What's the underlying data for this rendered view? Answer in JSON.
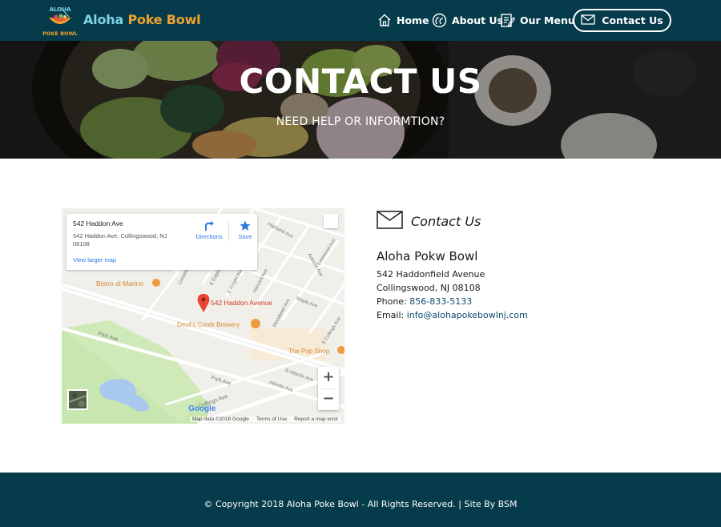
{
  "header": {
    "brand_part1": "Aloha",
    "brand_part2": "Poke Bowl",
    "logo_text_top": "ALOHA",
    "logo_text_bottom": "POKE BOWL",
    "nav": {
      "home": "Home",
      "about": "About Us",
      "menu": "Our Menu",
      "contact": "Contact Us"
    },
    "icons": [
      "home-icon",
      "about-icon",
      "menu-icon",
      "envelope-icon"
    ]
  },
  "hero": {
    "title": "CONTACT US",
    "subtitle": "NEED HELP OR INFORMTION?"
  },
  "map": {
    "card": {
      "title": "542 Haddon Ave",
      "address": "542 Haddon Ave, Collingswood, NJ 08108",
      "view_larger": "View larger map",
      "directions": "Directions",
      "save": "Save"
    },
    "labels": {
      "marker": "542 Haddon Avenue",
      "bistro": "Bistro di Marino",
      "brewery": "Devil's Creek Brewery",
      "popshop": "The Pop Shop",
      "highland": "Highland Ave",
      "eastwood": "Eastwood Ave",
      "autumn": "Autumn Ave",
      "maple": "Maple Ave",
      "woodlawn": "Woodlawn Ave",
      "harvard": "Harvard Ave",
      "knight": "E Knight Ave",
      "crestmont": "Crestmont",
      "park": "Park Ave",
      "park2": "Park Ave",
      "collings": "Collings Ave",
      "ecollings": "E Collings Ave",
      "atlantic": "Atlantic Ave",
      "natlantic": "N Atlantic Ave",
      "edgewood": "E Edgewood"
    },
    "google": "Google",
    "footer": {
      "mapdata": "Map data ©2018 Google",
      "terms": "Terms of Use",
      "report": "Report a map error"
    },
    "zoom_in": "+",
    "zoom_out": "−",
    "colors": {
      "park": "#c8e6b0",
      "water": "#a8c8ee",
      "road": "#ffffff",
      "marker": "#ea4335",
      "poi": "#f09a3e"
    }
  },
  "contact": {
    "heading": "Contact Us",
    "business_name": "Aloha Pokw Bowl",
    "street": "542 Haddonfield Avenue",
    "city": "Collingswood, NJ 08108",
    "phone_label": "Phone: ",
    "phone": "856-833-5133",
    "email_label": "Email: ",
    "email": "info@alohapokebowlnj.com"
  },
  "footer": {
    "text": "© Copyright 2018 Aloha Poke Bowl - All Rights Reserved. | Site By BSM"
  },
  "colors": {
    "header_bg": "#063b4c",
    "brand_blue": "#7fd3e6",
    "brand_orange": "#f0a030",
    "link": "#0b4a6e"
  }
}
